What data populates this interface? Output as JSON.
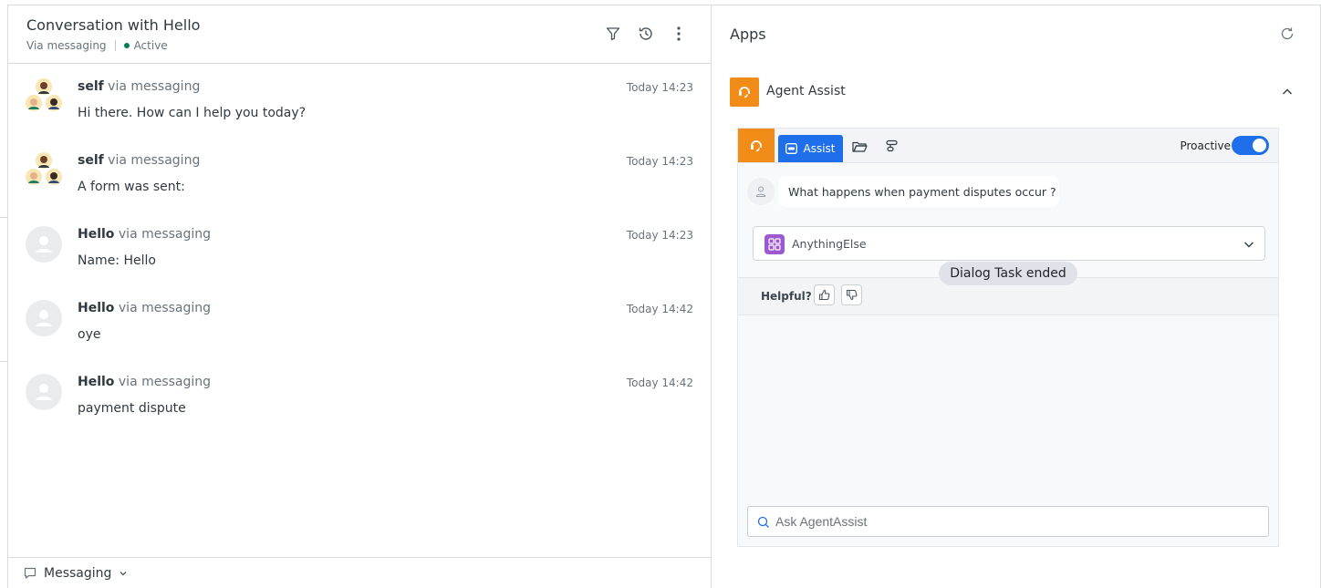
{
  "conversation": {
    "title": "Conversation with Hello",
    "channel": "Via messaging",
    "status": "Active",
    "status_color": "#038153",
    "header_icons": [
      "filter-icon",
      "history-icon",
      "more-vertical-icon"
    ],
    "messages": [
      {
        "sender": "self",
        "via": "via messaging",
        "time": "Today 14:23",
        "text": "Hi there. How can I help you today?",
        "avatar": "group-avatar"
      },
      {
        "sender": "self",
        "via": "via messaging",
        "time": "Today 14:23",
        "text": "A form was sent:",
        "avatar": "group-avatar"
      },
      {
        "sender": "Hello",
        "via": "via messaging",
        "time": "Today 14:23",
        "text": "Name: Hello",
        "avatar": "default-user-avatar"
      },
      {
        "sender": "Hello",
        "via": "via messaging",
        "time": "Today 14:42",
        "text": "oye",
        "avatar": "default-user-avatar"
      },
      {
        "sender": "Hello",
        "via": "via messaging",
        "time": "Today 14:42",
        "text": "payment dispute",
        "avatar": "default-user-avatar"
      }
    ],
    "footer": {
      "channel_label": "Messaging"
    }
  },
  "apps": {
    "title": "Apps",
    "app_name": "Agent Assist",
    "brand_color": "#f08c17",
    "accent_color": "#1f6feb",
    "assist": {
      "tab_label": "Assist",
      "proactive_label": "Proactive",
      "proactive_on": true,
      "question": "What happens when payment disputes occur ?",
      "intent_label": "AnythingElse",
      "ended_label": "Dialog Task ended",
      "helpful_label": "Helpful?",
      "ask_placeholder": "Ask AgentAssist"
    }
  }
}
